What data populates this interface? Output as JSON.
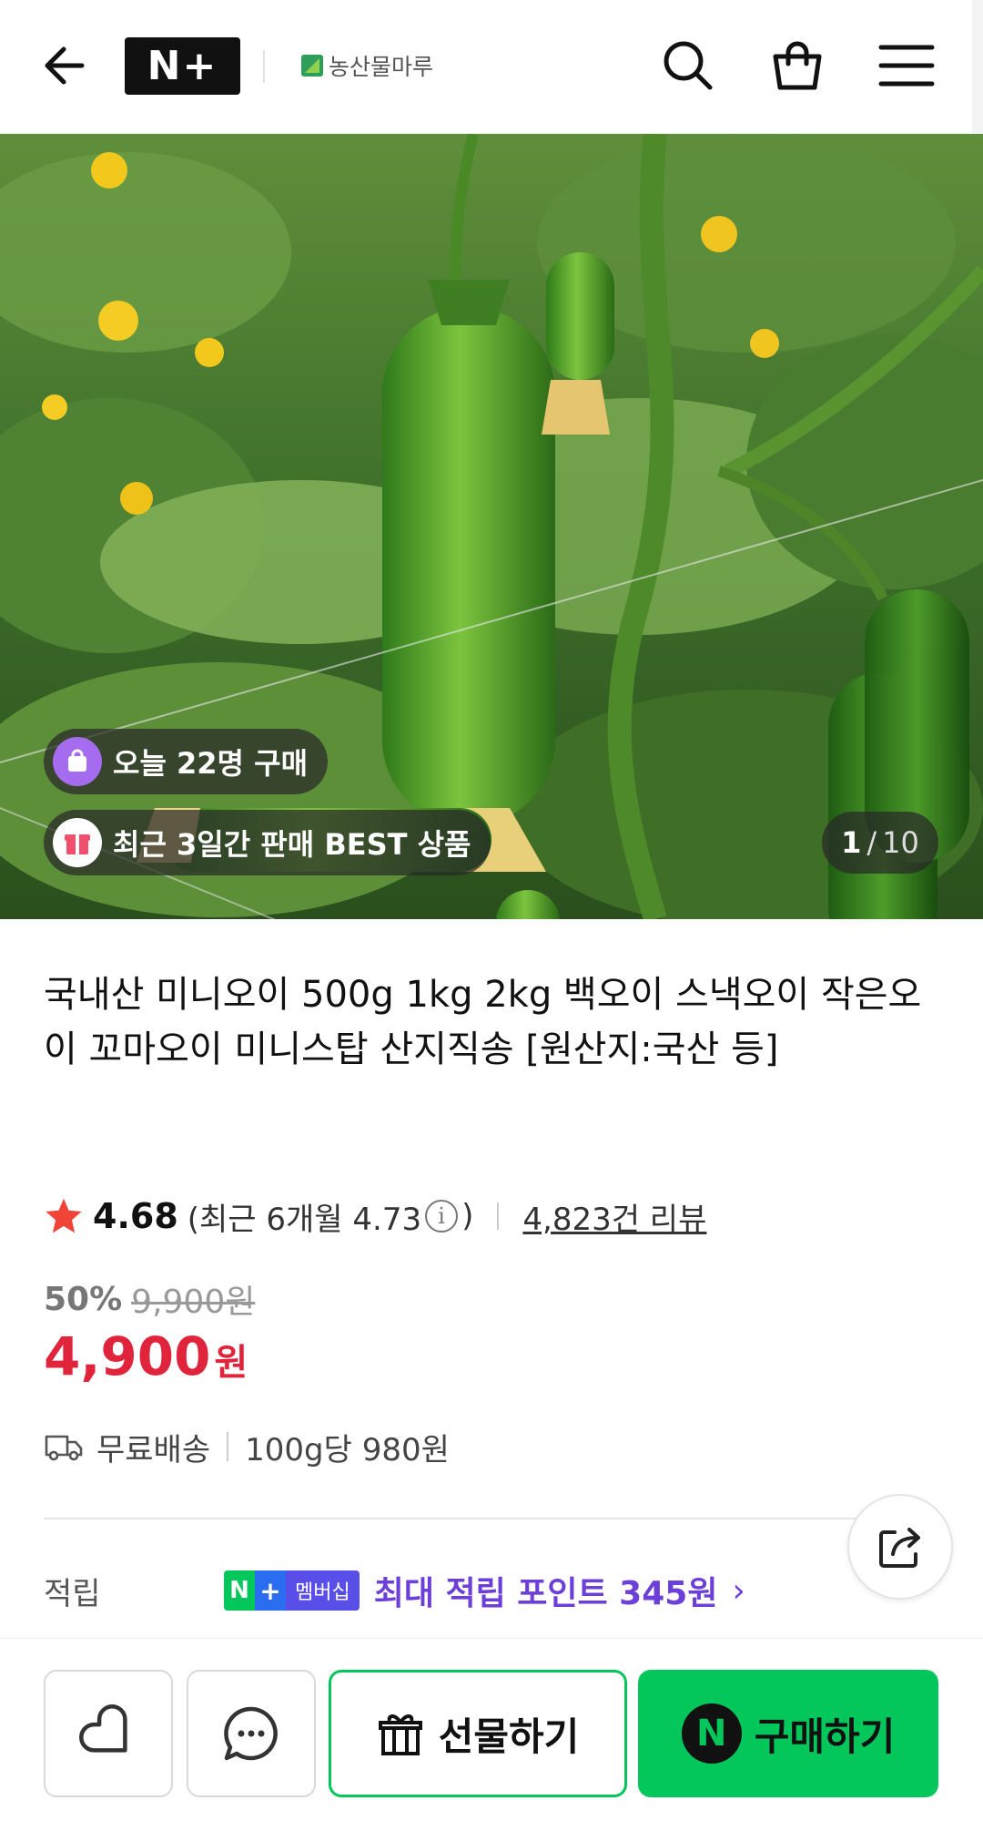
{
  "header": {
    "logo_text": "N+",
    "brand_name": "농산물마루"
  },
  "hero": {
    "badge_today": "오늘 22명 구매",
    "badge_best": "최근 3일간 판매 BEST 상품",
    "image_index": "1",
    "image_separator": "/",
    "image_total": "10"
  },
  "product": {
    "title": "국내산 미니오이 500g 1kg 2kg 백오이 스낵오이 작은오이 꼬마오이 미니스탑 산지직송 [원산지:국산 등]",
    "rating": "4.68",
    "recent_rating_prefix": "(최근 6개월 4.73",
    "recent_rating_suffix": ")",
    "info_glyph": "i",
    "review_count": "4,823건 리뷰",
    "discount_rate": "50%",
    "original_price": "9,900원",
    "price": "4,900",
    "price_unit": "원",
    "shipping": "무료배송",
    "unit_price": "100g당 980원"
  },
  "points": {
    "label": "적립",
    "badge_n": "N",
    "badge_plus": "+",
    "badge_text": "멤버십",
    "text": "최대 적립 포인트 345원",
    "chevron": "›"
  },
  "bottom_bar": {
    "gift_label": "선물하기",
    "buy_label": "구매하기",
    "buy_badge": "N"
  },
  "colors": {
    "naver_green": "#03c75a",
    "price_red": "#e0243c",
    "points_purple": "#6b3fd8"
  },
  "icons": [
    "back-arrow-icon",
    "search-icon",
    "cart-icon",
    "menu-icon",
    "star-icon",
    "info-icon",
    "truck-icon",
    "share-icon",
    "heart-icon",
    "chat-icon",
    "gift-icon"
  ]
}
